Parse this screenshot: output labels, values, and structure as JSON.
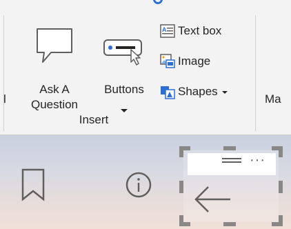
{
  "ribbon": {
    "left_cut_label": "l",
    "right_cut_label": "Ma",
    "group_label": "Insert",
    "ask_a_question": {
      "line1": "Ask A",
      "line2": "Question",
      "icon": "speech-bubble-icon"
    },
    "buttons": {
      "label": "Buttons",
      "icon": "button-cursor-icon"
    },
    "text_box": {
      "label": "Text box",
      "icon": "text-box-icon"
    },
    "image": {
      "label": "Image",
      "icon": "image-icon"
    },
    "shapes": {
      "label": "Shapes",
      "icon": "shapes-icon"
    }
  },
  "canvas": {
    "icons": [
      "bookmark-icon",
      "info-icon",
      "back-arrow-icon",
      "drag-handle-icon",
      "more-options-icon"
    ],
    "more_options_glyph": "···"
  },
  "colors": {
    "accent_blue": "#2b6fd6",
    "ribbon_bg": "#f3f3f3",
    "icon_gray": "#605e5c"
  }
}
